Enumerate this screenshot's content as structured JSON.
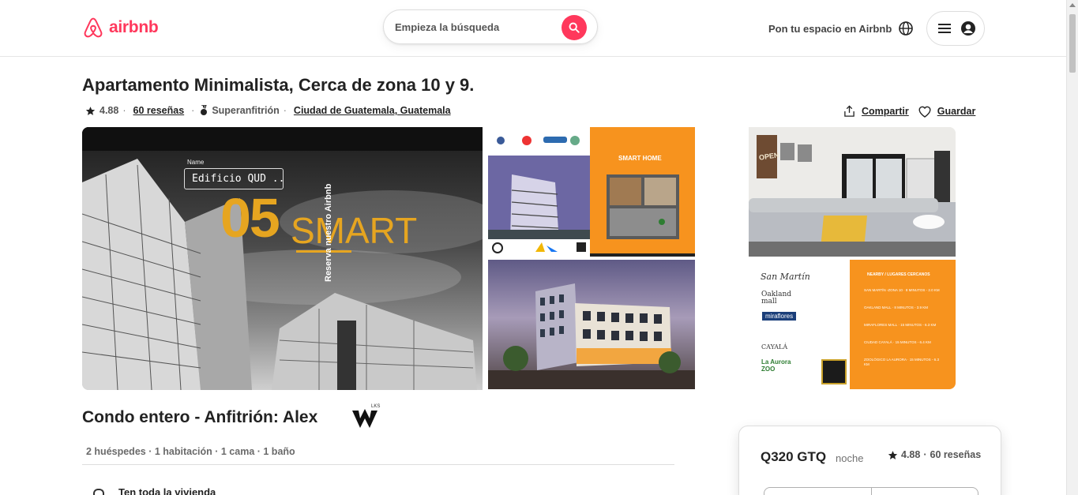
{
  "brand": {
    "name": "airbnb",
    "color": "#ff385c"
  },
  "header": {
    "search_placeholder": "Empieza la búsqueda",
    "host_link": "Pon tu espacio en Airbnb",
    "icons": [
      "search-icon",
      "globe-icon",
      "menu-icon",
      "user-icon"
    ]
  },
  "listing": {
    "title": "Apartamento Minimalista, Cerca de zona 10 y 9.",
    "rating": "4.88",
    "reviews_link": "60 reseñas",
    "superhost": "Superanfitrión",
    "location": "Ciudad de Guatemala, Guatemala",
    "share_label": "Compartir",
    "save_label": "Guardar"
  },
  "photos": {
    "main": {
      "name_label": "Name",
      "name_value": "Edificio QUD ..",
      "big_number": "05",
      "big_word": "SMART",
      "vertical_text": "Reserva nuestro Airbnb"
    },
    "p2": {
      "label": "SMART HOME"
    },
    "p4": {
      "sign": "OPEN"
    },
    "p5": {
      "header": "NEARBY / LUGARES CERCANOS",
      "brands": [
        "San Martín",
        "Oakland mall",
        "miraflores",
        "CAYALÁ",
        "La Aurora ZOO"
      ],
      "places": [
        "SAN MARTÍN -ZONA 10 · 8 MINUTOS - 2.0 KM",
        "OAKLAND MALL · 8 MINUTOS - 3.9 KM",
        "MIRAFLORES MALL · 15 MINUTOS - 6.3 KM",
        "CIUDAD CAYALÁ · 15 MINUTOS - 6.4 KM",
        "ZOOLÓGICO LA AURORA · 15 MINUTOS - 6.3 KM"
      ]
    }
  },
  "section": {
    "title": "Condo entero - Anfitrión: Alex",
    "host_logo_text": "LKS",
    "details": "2 huéspedes · 1 habitación · 1 cama · 1 baño",
    "peek_text": "Ten toda la vivienda"
  },
  "booking": {
    "price": "Q320 GTQ",
    "per": "noche",
    "rating": "4.88",
    "reviews": "60 reseñas"
  }
}
